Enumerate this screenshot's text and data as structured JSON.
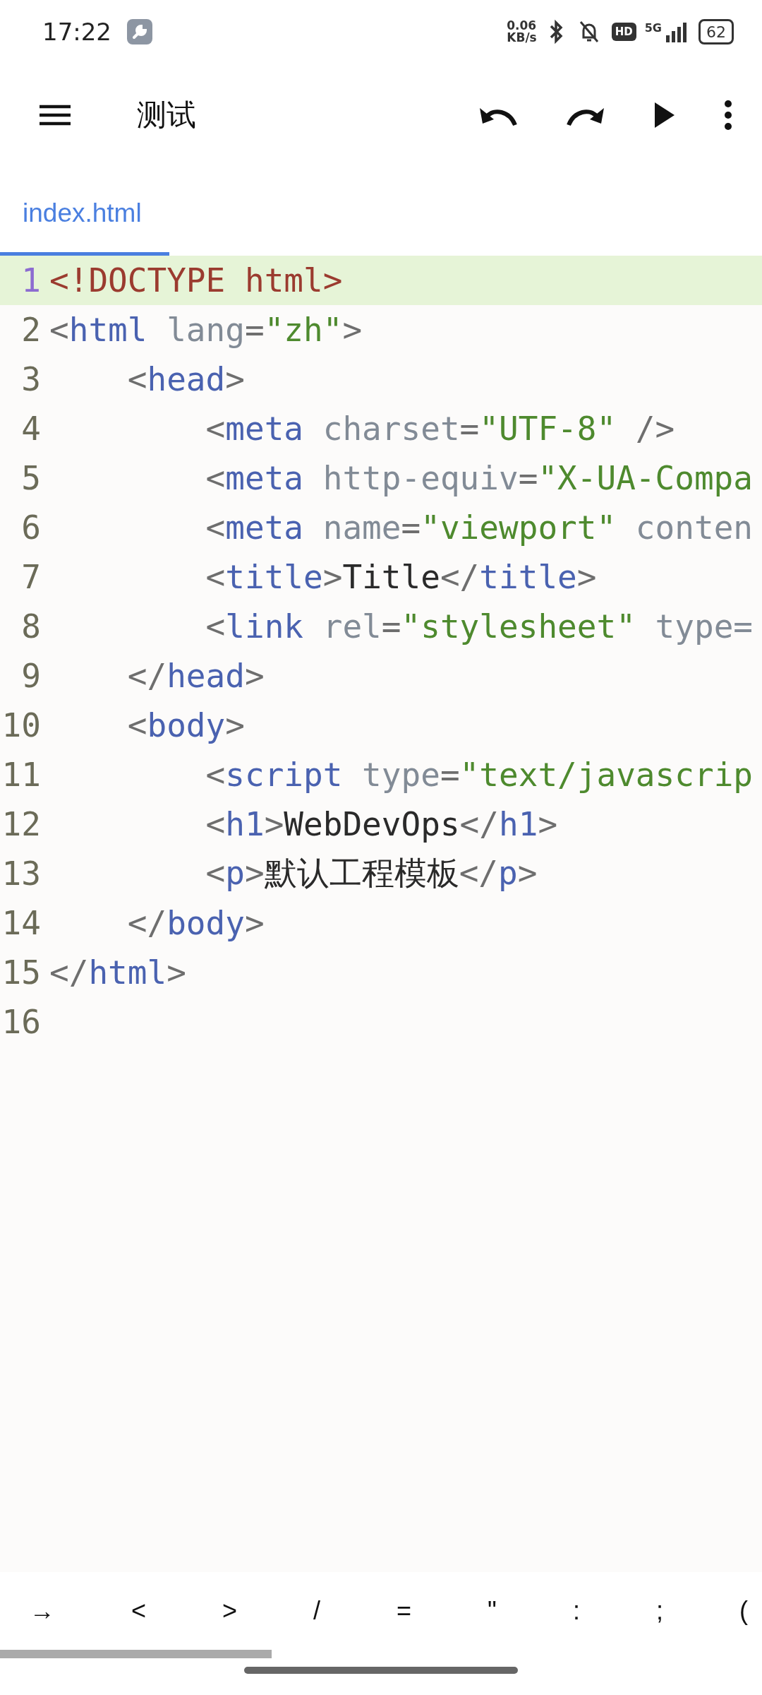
{
  "status_bar": {
    "time": "17:22",
    "net_speed": "0.06",
    "net_unit": "KB/s",
    "hd": "HD",
    "network": "5G",
    "battery": "62"
  },
  "toolbar": {
    "title": "测试"
  },
  "tabs": [
    {
      "label": "index.html",
      "selected": true
    }
  ],
  "editor": {
    "lines": [
      {
        "number": "1",
        "current": true,
        "tokens": [
          {
            "kind": "doctype",
            "text": "<!DOCTYPE html>"
          }
        ]
      },
      {
        "number": "2",
        "current": false,
        "tokens": [
          {
            "kind": "punct",
            "text": "<"
          },
          {
            "kind": "tag",
            "text": "html"
          },
          {
            "kind": "attr",
            "text": " lang"
          },
          {
            "kind": "punct",
            "text": "="
          },
          {
            "kind": "string",
            "text": "\"zh\""
          },
          {
            "kind": "punct",
            "text": ">"
          }
        ]
      },
      {
        "number": "3",
        "current": false,
        "tokens": [
          {
            "kind": "punct",
            "text": "    <"
          },
          {
            "kind": "tag",
            "text": "head"
          },
          {
            "kind": "punct",
            "text": ">"
          }
        ]
      },
      {
        "number": "4",
        "current": false,
        "tokens": [
          {
            "kind": "punct",
            "text": "        <"
          },
          {
            "kind": "tag",
            "text": "meta"
          },
          {
            "kind": "attr",
            "text": " charset"
          },
          {
            "kind": "punct",
            "text": "="
          },
          {
            "kind": "string",
            "text": "\"UTF-8\""
          },
          {
            "kind": "punct",
            "text": " />"
          }
        ]
      },
      {
        "number": "5",
        "current": false,
        "tokens": [
          {
            "kind": "punct",
            "text": "        <"
          },
          {
            "kind": "tag",
            "text": "meta"
          },
          {
            "kind": "attr",
            "text": " http-equiv"
          },
          {
            "kind": "punct",
            "text": "="
          },
          {
            "kind": "string",
            "text": "\"X-UA-Compa"
          }
        ]
      },
      {
        "number": "6",
        "current": false,
        "tokens": [
          {
            "kind": "punct",
            "text": "        <"
          },
          {
            "kind": "tag",
            "text": "meta"
          },
          {
            "kind": "attr",
            "text": " name"
          },
          {
            "kind": "punct",
            "text": "="
          },
          {
            "kind": "string",
            "text": "\"viewport\""
          },
          {
            "kind": "attr",
            "text": " conten"
          }
        ]
      },
      {
        "number": "7",
        "current": false,
        "tokens": [
          {
            "kind": "punct",
            "text": "        <"
          },
          {
            "kind": "tag",
            "text": "title"
          },
          {
            "kind": "punct",
            "text": ">"
          },
          {
            "kind": "text",
            "text": "Title"
          },
          {
            "kind": "punct",
            "text": "</"
          },
          {
            "kind": "tag",
            "text": "title"
          },
          {
            "kind": "punct",
            "text": ">"
          }
        ]
      },
      {
        "number": "8",
        "current": false,
        "tokens": [
          {
            "kind": "punct",
            "text": "        <"
          },
          {
            "kind": "tag",
            "text": "link"
          },
          {
            "kind": "attr",
            "text": " rel"
          },
          {
            "kind": "punct",
            "text": "="
          },
          {
            "kind": "string",
            "text": "\"stylesheet\""
          },
          {
            "kind": "attr",
            "text": " type="
          }
        ]
      },
      {
        "number": "9",
        "current": false,
        "tokens": [
          {
            "kind": "punct",
            "text": "    </"
          },
          {
            "kind": "tag",
            "text": "head"
          },
          {
            "kind": "punct",
            "text": ">"
          }
        ]
      },
      {
        "number": "10",
        "current": false,
        "tokens": [
          {
            "kind": "punct",
            "text": "    <"
          },
          {
            "kind": "tag",
            "text": "body"
          },
          {
            "kind": "punct",
            "text": ">"
          }
        ]
      },
      {
        "number": "11",
        "current": false,
        "tokens": [
          {
            "kind": "punct",
            "text": "        <"
          },
          {
            "kind": "tag",
            "text": "script"
          },
          {
            "kind": "attr",
            "text": " type"
          },
          {
            "kind": "punct",
            "text": "="
          },
          {
            "kind": "string",
            "text": "\"text/javascrip"
          }
        ]
      },
      {
        "number": "12",
        "current": false,
        "tokens": [
          {
            "kind": "punct",
            "text": "        <"
          },
          {
            "kind": "tag",
            "text": "h1"
          },
          {
            "kind": "punct",
            "text": ">"
          },
          {
            "kind": "text",
            "text": "WebDevOps"
          },
          {
            "kind": "punct",
            "text": "</"
          },
          {
            "kind": "tag",
            "text": "h1"
          },
          {
            "kind": "punct",
            "text": ">"
          }
        ]
      },
      {
        "number": "13",
        "current": false,
        "tokens": [
          {
            "kind": "punct",
            "text": "        <"
          },
          {
            "kind": "tag",
            "text": "p"
          },
          {
            "kind": "punct",
            "text": ">"
          },
          {
            "kind": "text",
            "text": "默认工程模板"
          },
          {
            "kind": "punct",
            "text": "</"
          },
          {
            "kind": "tag",
            "text": "p"
          },
          {
            "kind": "punct",
            "text": ">"
          }
        ]
      },
      {
        "number": "14",
        "current": false,
        "tokens": [
          {
            "kind": "punct",
            "text": "    </"
          },
          {
            "kind": "tag",
            "text": "body"
          },
          {
            "kind": "punct",
            "text": ">"
          }
        ]
      },
      {
        "number": "15",
        "current": false,
        "tokens": [
          {
            "kind": "punct",
            "text": "</"
          },
          {
            "kind": "tag",
            "text": "html"
          },
          {
            "kind": "punct",
            "text": ">"
          }
        ]
      },
      {
        "number": "16",
        "current": false
      }
    ]
  },
  "symbol_keys": [
    "→",
    "<",
    ">",
    "/",
    "=",
    "\"",
    ":",
    ";",
    "("
  ]
}
